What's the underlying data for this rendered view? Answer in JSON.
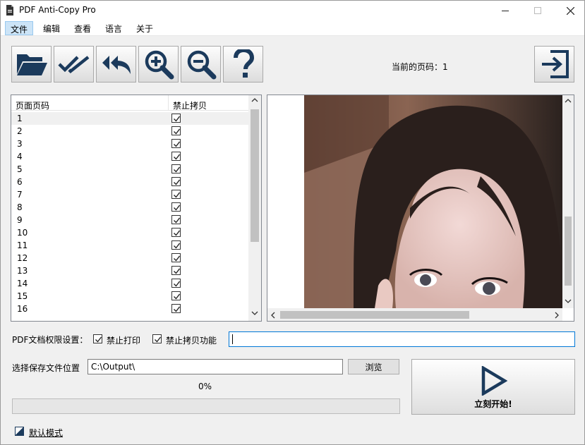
{
  "window": {
    "title": "PDF Anti-Copy Pro",
    "controls": [
      "minimize",
      "maximize",
      "close"
    ]
  },
  "menu": {
    "items": [
      {
        "label": "文件",
        "active": true
      },
      {
        "label": "编辑"
      },
      {
        "label": "查看"
      },
      {
        "label": "语言"
      },
      {
        "label": "关于"
      }
    ]
  },
  "toolbar": {
    "buttons": [
      {
        "name": "open-file-button",
        "icon": "folder-open-icon"
      },
      {
        "name": "check-all-button",
        "icon": "double-check-icon"
      },
      {
        "name": "undo-all-button",
        "icon": "double-reply-icon"
      },
      {
        "name": "zoom-in-button",
        "icon": "zoom-in-icon"
      },
      {
        "name": "zoom-out-button",
        "icon": "zoom-out-icon"
      },
      {
        "name": "help-button",
        "icon": "question-icon"
      }
    ],
    "page_indicator_label": "当前的页码：",
    "current_page": "1",
    "exit_icon": "exit-icon"
  },
  "page_table": {
    "columns": [
      "页面页码",
      "禁止拷贝"
    ],
    "rows": [
      {
        "page": "1",
        "checked": true
      },
      {
        "page": "2",
        "checked": true
      },
      {
        "page": "3",
        "checked": true
      },
      {
        "page": "4",
        "checked": true
      },
      {
        "page": "5",
        "checked": true
      },
      {
        "page": "6",
        "checked": true
      },
      {
        "page": "7",
        "checked": true
      },
      {
        "page": "8",
        "checked": true
      },
      {
        "page": "9",
        "checked": true
      },
      {
        "page": "10",
        "checked": true
      },
      {
        "page": "11",
        "checked": true
      },
      {
        "page": "12",
        "checked": true
      },
      {
        "page": "13",
        "checked": true
      },
      {
        "page": "14",
        "checked": true
      },
      {
        "page": "15",
        "checked": true
      },
      {
        "page": "16",
        "checked": true
      }
    ]
  },
  "permissions": {
    "label": "PDF文档权限设置：",
    "no_print_label": "禁止打印",
    "no_print_checked": true,
    "no_copy_label": "禁止拷贝功能",
    "no_copy_checked": true,
    "password_value": ""
  },
  "output": {
    "label": "选择保存文件位置",
    "path": "C:\\Output\\",
    "browse_label": "浏览",
    "progress_text": "0%",
    "progress_value": 0
  },
  "start_button": {
    "label": "立刻开始!",
    "icon": "play-icon"
  },
  "mode": {
    "label": "默认模式",
    "icon": "mode-toggle-icon"
  },
  "colors": {
    "menu_active_bg": "#cce4f7",
    "icon_dark": "#1b3a5c",
    "input_focus": "#0078d7"
  }
}
